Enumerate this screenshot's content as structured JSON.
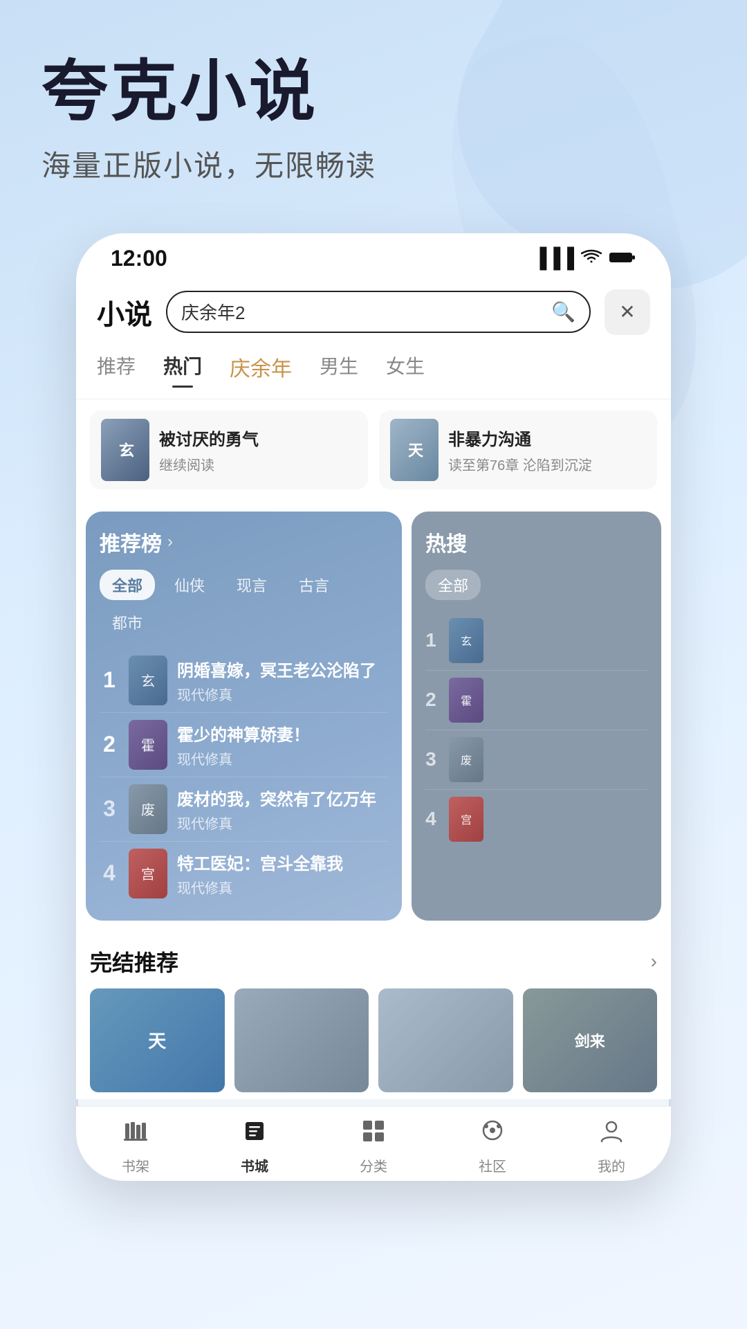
{
  "app": {
    "title": "夸克小说",
    "subtitle": "海量正版小说，无限畅读"
  },
  "statusBar": {
    "time": "12:00"
  },
  "topNav": {
    "title": "小说",
    "searchPlaceholder": "庆余年2",
    "searchValue": "庆余年2"
  },
  "tabs": [
    {
      "id": "recommend",
      "label": "推荐",
      "active": false
    },
    {
      "id": "hot",
      "label": "热门",
      "active": true
    },
    {
      "id": "yuqing",
      "label": "庆余年",
      "active": false,
      "special": true
    },
    {
      "id": "male",
      "label": "男生",
      "active": false
    },
    {
      "id": "female",
      "label": "女生",
      "active": false
    }
  ],
  "recentReads": [
    {
      "title": "被讨厌的勇气",
      "sub": "继续阅读",
      "coverColor": "cover-blue"
    },
    {
      "title": "非暴力沟通",
      "sub": "读至第76章 沦陷到沉淀",
      "coverColor": "cover-gray"
    }
  ],
  "recommendRank": {
    "title": "推荐榜",
    "arrow": "›",
    "filters": [
      {
        "label": "全部",
        "active": true
      },
      {
        "label": "仙侠",
        "active": false
      },
      {
        "label": "现言",
        "active": false
      },
      {
        "label": "古言",
        "active": false
      },
      {
        "label": "都市",
        "active": false
      }
    ],
    "items": [
      {
        "rank": "1",
        "title": "阴婚喜嫁，冥王老公沦陷了",
        "genre": "现代修真",
        "coverColor": "cover-blue",
        "coverText": "玄"
      },
      {
        "rank": "2",
        "title": "霍少的神算娇妻！",
        "genre": "现代修真",
        "coverColor": "cover-purple",
        "coverText": "霍"
      },
      {
        "rank": "3",
        "title": "废材的我，突然有了亿万年",
        "genre": "现代修真",
        "coverColor": "cover-gray",
        "coverText": "废"
      },
      {
        "rank": "4",
        "title": "特工医妃：宫斗全靠我",
        "genre": "现代修真",
        "coverColor": "cover-red",
        "coverText": "宫"
      }
    ]
  },
  "hotSearch": {
    "title": "热搜",
    "filters": [
      {
        "label": "全部",
        "active": true
      }
    ],
    "items": [
      {
        "rank": "1",
        "coverColor": "cover-blue",
        "coverText": ""
      },
      {
        "rank": "2",
        "coverColor": "cover-purple",
        "coverText": ""
      },
      {
        "rank": "3",
        "coverColor": "cover-gray",
        "coverText": ""
      },
      {
        "rank": "4",
        "coverColor": "cover-red",
        "coverText": ""
      }
    ]
  },
  "completeSection": {
    "title": "完结推荐",
    "arrow": "›",
    "books": [
      {
        "coverColor": "cover-sky",
        "coverText": "天"
      },
      {
        "coverColor": "cover-light",
        "coverText": ""
      },
      {
        "coverColor": "cover-char",
        "coverText": ""
      },
      {
        "coverColor": "cover-sword",
        "coverText": "剑来"
      }
    ]
  },
  "bottomBar": {
    "tabs": [
      {
        "id": "bookshelf",
        "label": "书架",
        "icon": "📚",
        "active": false
      },
      {
        "id": "bookstore",
        "label": "书城",
        "icon": "📖",
        "active": true
      },
      {
        "id": "category",
        "label": "分类",
        "icon": "⊞",
        "active": false
      },
      {
        "id": "community",
        "label": "社区",
        "icon": "💬",
        "active": false
      },
      {
        "id": "mine",
        "label": "我的",
        "icon": "👤",
        "active": false
      }
    ]
  }
}
